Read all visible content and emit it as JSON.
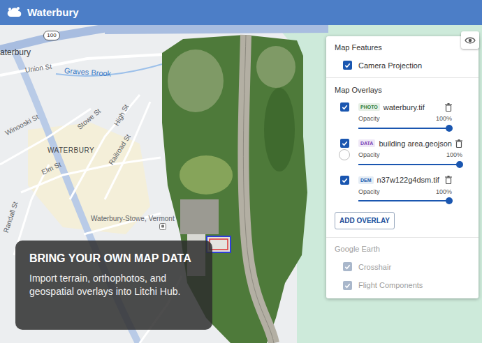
{
  "header": {
    "title": "Waterbury"
  },
  "map": {
    "route_shield": "100",
    "labels": [
      "aterbury",
      "Union St",
      "Graves Brook",
      "Winooski St",
      "Stowe St",
      "High St",
      "WATERBURY",
      "Elm St",
      "Railroad St",
      "Randall St",
      "Waterbury-Stowe, Vermont"
    ]
  },
  "panel": {
    "features": {
      "heading": "Map Features",
      "items": [
        {
          "label": "Camera Projection",
          "checked": true
        }
      ]
    },
    "overlays": {
      "heading": "Map Overlays",
      "items": [
        {
          "kind": "photo",
          "badge": "PHOTO",
          "name": "waterbury.tif",
          "checked": true,
          "opacity_label": "Opacity",
          "opacity": "100%",
          "level": 1,
          "color": "#2e7d32"
        },
        {
          "kind": "data",
          "badge": "DATA",
          "name": "building area.geojson",
          "checked": true,
          "opacity_label": "Opacity",
          "opacity": "100%",
          "level": 1,
          "color": "#7b3fb5"
        },
        {
          "kind": "dem",
          "badge": "DEM",
          "name": "n37w122g4dsm.tif",
          "checked": true,
          "opacity_label": "Opacity",
          "opacity": "100%",
          "level": 1,
          "color": "#1f5fae"
        }
      ],
      "add_button": "ADD OVERLAY"
    },
    "google_earth": {
      "heading": "Google Earth",
      "disabled": true,
      "items": [
        {
          "label": "Crosshair",
          "checked": true,
          "disabled": true
        },
        {
          "label": "Flight Components",
          "checked": true,
          "disabled": true
        }
      ]
    }
  },
  "promo": {
    "title": "BRING YOUR OWN MAP DATA",
    "body": "Import terrain, orthophotos, and geospatial overlays into Litchi Hub."
  }
}
